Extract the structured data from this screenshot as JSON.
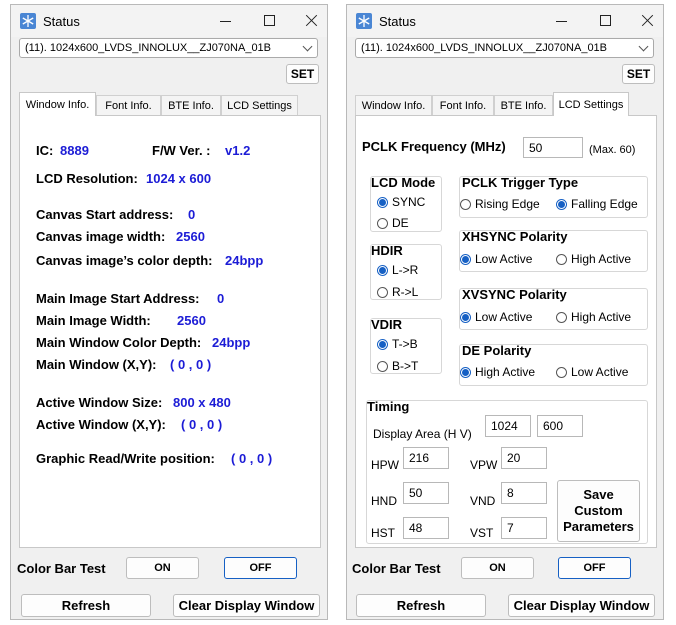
{
  "left": {
    "title": "Status",
    "panel_select": "(11). 1024x600_LVDS_INNOLUX__ZJ070NA_01B",
    "set_label": "SET",
    "tabs": [
      "Window Info.",
      "Font Info.",
      "BTE Info.",
      "LCD Settings"
    ],
    "active_tab": "Window Info.",
    "info": {
      "ic_label": "IC:",
      "ic_value": "8889",
      "fw_label": "F/W Ver. :",
      "fw_value": "v1.2",
      "lcd_res_label": "LCD Resolution:",
      "lcd_res_value": "1024 x 600",
      "canvas_start_label": "Canvas Start address:",
      "canvas_start_value": "0",
      "canvas_width_label": "Canvas image width:",
      "canvas_width_value": "2560",
      "canvas_depth_label": "Canvas image’s color depth:",
      "canvas_depth_value": "24bpp",
      "main_start_label": "Main Image Start Address:",
      "main_start_value": "0",
      "main_width_label": "Main Image Width:",
      "main_width_value": "2560",
      "main_depth_label": "Main Window Color Depth:",
      "main_depth_value": "24bpp",
      "main_xy_label": "Main Window (X,Y):",
      "main_xy_value": "( 0 , 0 )",
      "active_size_label": "Active Window Size:",
      "active_size_value": "800 x 480",
      "active_xy_label": "Active Window (X,Y):",
      "active_xy_value": "( 0 , 0 )",
      "graphic_pos_label": "Graphic Read/Write position:",
      "graphic_pos_value": "( 0 , 0 )"
    },
    "color_bar_label": "Color Bar Test",
    "on_label": "ON",
    "off_label": "OFF",
    "refresh_label": "Refresh",
    "clear_label": "Clear Display Window"
  },
  "right": {
    "title": "Status",
    "panel_select": "(11). 1024x600_LVDS_INNOLUX__ZJ070NA_01B",
    "set_label": "SET",
    "tabs": [
      "Window Info.",
      "Font Info.",
      "BTE Info.",
      "LCD Settings"
    ],
    "active_tab": "LCD Settings",
    "lcd": {
      "pclk_label": "PCLK Frequency (MHz)",
      "pclk_value": "50",
      "pclk_max": "(Max. 60)",
      "lcd_mode": {
        "title": "LCD Mode",
        "options": [
          "SYNC",
          "DE"
        ],
        "selected": "SYNC"
      },
      "hdir": {
        "title": "HDIR",
        "options": [
          "L->R",
          "R->L"
        ],
        "selected": "L->R"
      },
      "vdir": {
        "title": "VDIR",
        "options": [
          "T->B",
          "B->T"
        ],
        "selected": "T->B"
      },
      "pclk_trigger": {
        "title": "PCLK Trigger Type",
        "options": [
          "Rising Edge",
          "Falling Edge"
        ],
        "selected": "Falling Edge"
      },
      "xhsync": {
        "title": "XHSYNC Polarity",
        "options": [
          "Low Active",
          "High Active"
        ],
        "selected": "Low Active"
      },
      "xvsync": {
        "title": "XVSYNC Polarity",
        "options": [
          "Low Active",
          "High Active"
        ],
        "selected": "Low Active"
      },
      "de_polarity": {
        "title": "DE Polarity",
        "options": [
          "High Active",
          "Low Active"
        ],
        "selected": "High Active"
      },
      "timing": {
        "title": "Timing",
        "display_area_label": "Display Area (H V)",
        "display_h": "1024",
        "display_v": "600",
        "hpw_label": "HPW",
        "hpw": "216",
        "vpw_label": "VPW",
        "vpw": "20",
        "hnd_label": "HND",
        "hnd": "50",
        "vnd_label": "VND",
        "vnd": "8",
        "hst_label": "HST",
        "hst": "48",
        "vst_label": "VST",
        "vst": "7",
        "save_label_1": "Save",
        "save_label_2": "Custom",
        "save_label_3": "Parameters"
      }
    },
    "color_bar_label": "Color Bar Test",
    "on_label": "ON",
    "off_label": "OFF",
    "refresh_label": "Refresh",
    "clear_label": "Clear Display Window"
  }
}
